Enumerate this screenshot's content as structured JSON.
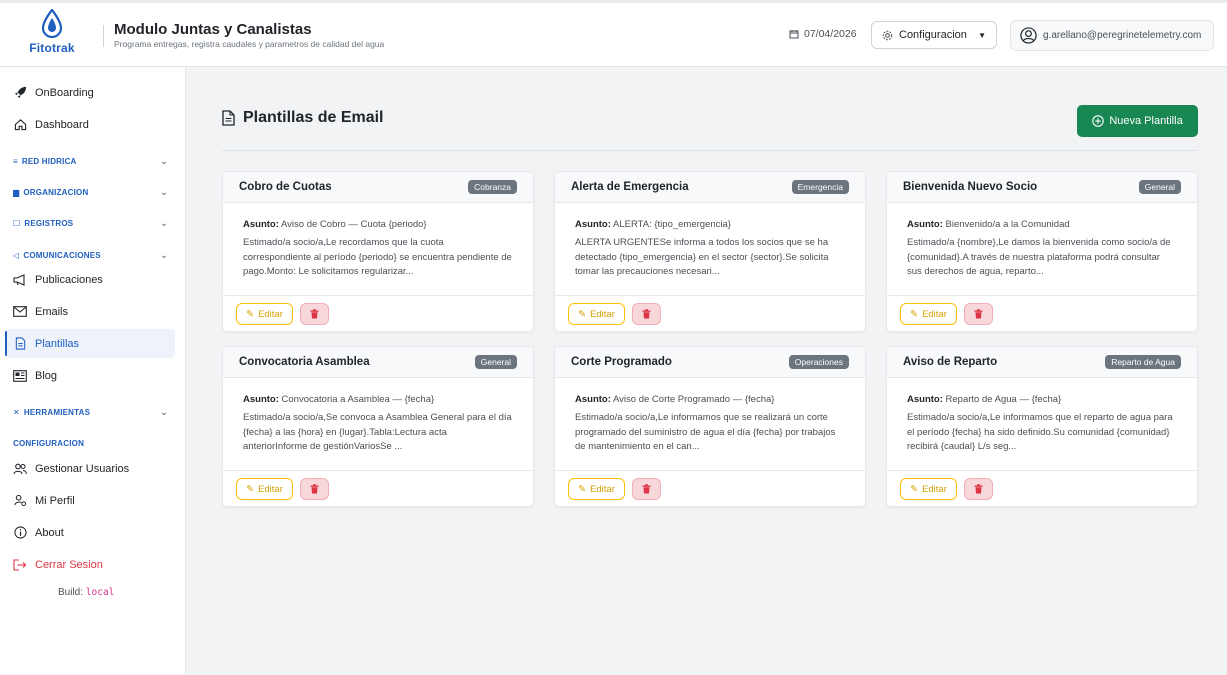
{
  "header": {
    "logo_text": "Fitotrak",
    "title": "Modulo Juntas y Canalistas",
    "subtitle": "Programa entregas, registra caudales y parametros de calidad del agua",
    "date": "07/04/2026",
    "config_label": "Configuracion",
    "user_email": "g.arellano@peregrinetelemetry.com",
    "brand_color": "#1f5fbf"
  },
  "sidebar": {
    "onboarding": "OnBoarding",
    "dashboard": "Dashboard",
    "red_hidrica": "RED HIDRICA",
    "organizacion": "ORGANIZACION",
    "registros": "REGISTROS",
    "comunicaciones": "COMUNICACIONES",
    "publicaciones": "Publicaciones",
    "emails": "Emails",
    "plantillas": "Plantillas",
    "blog": "Blog",
    "herramientas": "HERRAMIENTAS",
    "configuracion": "CONFIGURACION",
    "gestionar_usuarios": "Gestionar Usuarios",
    "mi_perfil": "Mi Perfil",
    "about": "About",
    "cerrar_sesion": "Cerrar Sesion",
    "build_label": "Build:",
    "build_value": "local"
  },
  "main": {
    "page_title": "Plantillas de Email",
    "new_button": "Nueva Plantilla",
    "subject_label": "Asunto:",
    "edit_label": "Editar",
    "templates": [
      {
        "title": "Cobro de Cuotas",
        "badge": "Cobranza",
        "subject": "Aviso de Cobro — Cuota {periodo}",
        "preview": "Estimado/a socio/a,Le recordamos que la cuota correspondiente al período {periodo} se encuentra pendiente de pago.Monto: Le solicitamos regularizar..."
      },
      {
        "title": "Alerta de Emergencia",
        "badge": "Emergencia",
        "subject": "ALERTA: {tipo_emergencia}",
        "preview": "ALERTA URGENTESe informa a todos los socios que se ha detectado {tipo_emergencia} en el sector {sector}.Se solicita tomar las precauciones necesari..."
      },
      {
        "title": "Bienvenida Nuevo Socio",
        "badge": "General",
        "subject": "Bienvenido/a a la Comunidad",
        "preview": "Estimado/a {nombre},Le damos la bienvenida como socio/a de {comunidad}.A través de nuestra plataforma podrá consultar sus derechos de agua, reparto..."
      },
      {
        "title": "Convocatoria Asamblea",
        "badge": "General",
        "subject": "Convocatoria a Asamblea — {fecha}",
        "preview": "Estimado/a socio/a,Se convoca a Asamblea General para el día {fecha} a las {hora} en {lugar}.Tabla:Lectura acta anteriorInforme de gestiónVariosSe ..."
      },
      {
        "title": "Corte Programado",
        "badge": "Operaciones",
        "subject": "Aviso de Corte Programado — {fecha}",
        "preview": "Estimado/a socio/a,Le informamos que se realizará un corte programado del suministro de agua el día {fecha} por trabajos de mantenimiento en el can..."
      },
      {
        "title": "Aviso de Reparto",
        "badge": "Reparto de Agua",
        "subject": "Reparto de Agua — {fecha}",
        "preview": "Estimado/a socio/a,Le informamos que el reparto de agua para el período {fecha} ha sido definido.Su comunidad {comunidad} recibirá {caudal} L/s seg..."
      }
    ]
  }
}
